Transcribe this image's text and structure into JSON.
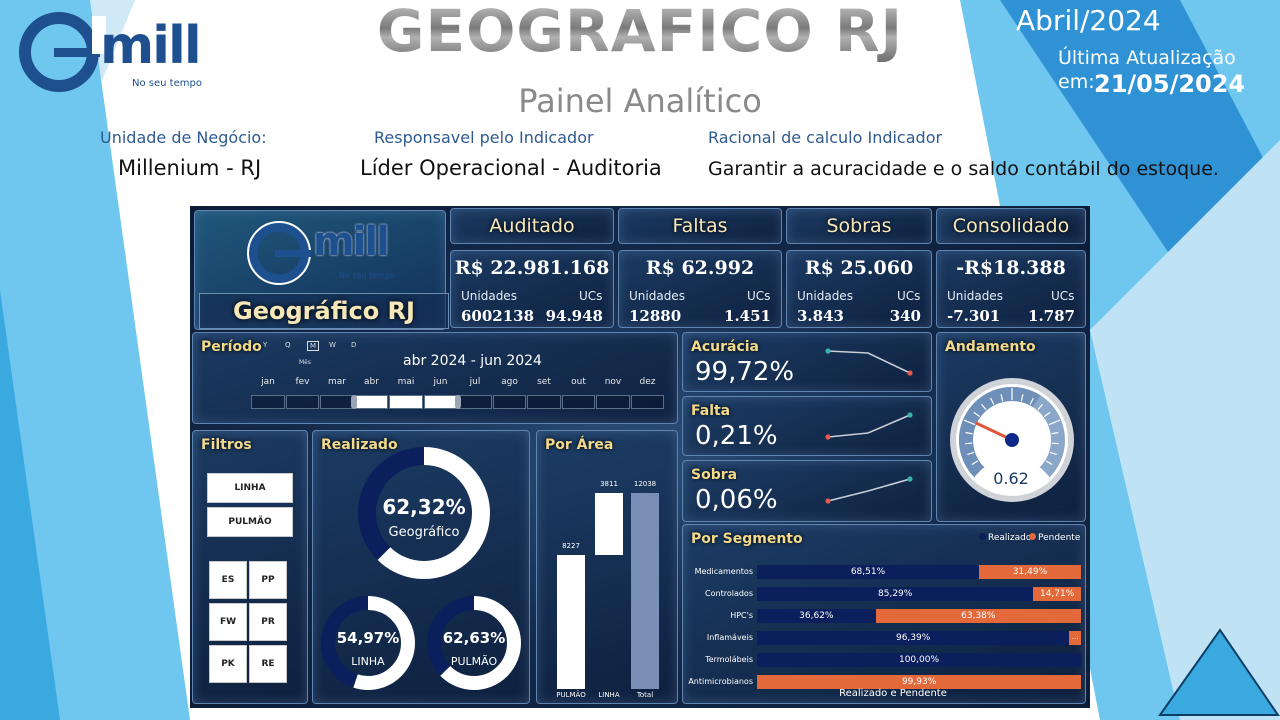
{
  "header": {
    "title": "GEOGRAFICO RJ",
    "subtitle": "Painel Analítico",
    "month": "Abril/2024",
    "update_label": "Última Atualização em:",
    "update_date": "21/05/2024",
    "logo_text": "mill",
    "logo_tagline": "No seu tempo"
  },
  "meta": {
    "unit_label": "Unidade de Negócio:",
    "unit_value": "Millenium - RJ",
    "resp_label": "Responsavel pelo Indicador",
    "resp_value": "Líder Operacional - Auditoria",
    "rational_label": "Racional de calculo Indicador",
    "rational_value": "Garantir a acuracidade e o saldo contábil do estoque."
  },
  "dashboard": {
    "brand_title": "Geográfico RJ",
    "logo_text": "mill",
    "logo_tagline": "No seu tempo",
    "kpis": [
      {
        "title": "Auditado",
        "value": "R$ 22.981.168",
        "units_label": "Unidades",
        "units": "6002138",
        "ucs_label": "UCs",
        "ucs": "94.948"
      },
      {
        "title": "Faltas",
        "value": "R$ 62.992",
        "units_label": "Unidades",
        "units": "12880",
        "ucs_label": "UCs",
        "ucs": "1.451"
      },
      {
        "title": "Sobras",
        "value": "R$ 25.060",
        "units_label": "Unidades",
        "units": "3.843",
        "ucs_label": "UCs",
        "ucs": "340"
      },
      {
        "title": "Consolidado",
        "value": "-R$18.388",
        "units_label": "Unidades",
        "units": "-7.301",
        "ucs_label": "UCs",
        "ucs": "1.787"
      }
    ],
    "periodo": {
      "title": "Período",
      "levels": [
        "Y",
        "Q",
        "M",
        "W",
        "D"
      ],
      "level_caption": "Mês",
      "range": "abr 2024 - jun 2024",
      "months": [
        "jan",
        "fev",
        "mar",
        "abr",
        "mai",
        "jun",
        "jul",
        "ago",
        "set",
        "out",
        "nov",
        "dez"
      ],
      "selected_start": 3,
      "selected_end": 5
    },
    "metrics": [
      {
        "title": "Acurácia",
        "value": "99,72%"
      },
      {
        "title": "Falta",
        "value": "0,21%"
      },
      {
        "title": "Sobra",
        "value": "0,06%"
      }
    ],
    "andamento": {
      "title": "Andamento",
      "value": "0.62",
      "fraction": 0.62
    },
    "filtros": {
      "title": "Filtros",
      "wide": [
        "LINHA",
        "PULMÃO"
      ],
      "grid": [
        "ES",
        "PP",
        "FW",
        "PR",
        "PK",
        "RE"
      ]
    },
    "realizado": {
      "title": "Realizado",
      "main": {
        "value": "62,32%",
        "label": "Geográfico",
        "fraction": 0.6232
      },
      "small": [
        {
          "value": "54,97%",
          "label": "LINHA",
          "fraction": 0.5497
        },
        {
          "value": "62,63%",
          "label": "PULMÃO",
          "fraction": 0.6263
        }
      ]
    },
    "por_area": {
      "title": "Por Área",
      "categories": [
        "PULMÃO",
        "LINHA",
        "Total"
      ],
      "values": [
        "8227",
        "3811",
        "12038"
      ]
    },
    "por_segmento": {
      "title": "Por Segmento",
      "legend": [
        "Realizado",
        "Pendente"
      ],
      "footer": "Realizado e Pendente",
      "colors": {
        "realizado": "#0a1f5c",
        "pendente": "#e3693a"
      }
    }
  },
  "chart_data": [
    {
      "type": "bar",
      "title": "Por Área",
      "categories": [
        "PULMÃO",
        "LINHA",
        "Total"
      ],
      "values": [
        8227,
        3811,
        12038
      ],
      "note_type": "waterfall"
    },
    {
      "type": "bar",
      "title": "Por Segmento",
      "xlabel": "Realizado e Pendente",
      "categories": [
        "Medicamentos",
        "Controlados",
        "HPC's",
        "Inflamáveis",
        "Termolábeis",
        "Antimicrobianos"
      ],
      "series": [
        {
          "name": "Realizado",
          "values": [
            68.51,
            85.29,
            36.62,
            96.39,
            100.0,
            0.07
          ],
          "labels": [
            "68,51%",
            "85,29%",
            "36,62%",
            "96,39%",
            "100,00%",
            ""
          ]
        },
        {
          "name": "Pendente",
          "values": [
            31.49,
            14.71,
            63.38,
            3.61,
            0.0,
            99.93
          ],
          "labels": [
            "31,49%",
            "14,71%",
            "63,38%",
            "...",
            "",
            "99,93%"
          ]
        }
      ],
      "ylim": [
        0,
        100
      ],
      "stacked": true,
      "orientation": "horizontal"
    }
  ]
}
